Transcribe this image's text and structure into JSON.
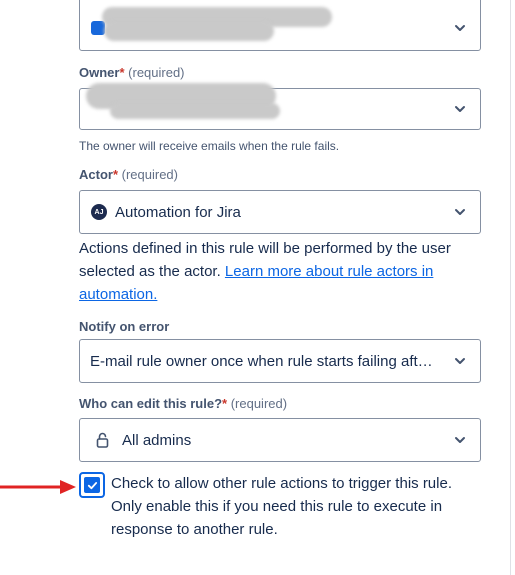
{
  "project_field": {
    "value": ""
  },
  "owner": {
    "label": "Owner",
    "required_star": "*",
    "required_text": "(required)",
    "value": "",
    "helper": "The owner will receive emails when the rule fails."
  },
  "actor": {
    "label": "Actor",
    "required_star": "*",
    "required_text": "(required)",
    "avatar_initials": "AJ",
    "value": "Automation for Jira",
    "description": "Actions defined in this rule will be performed by the user selected as the actor. ",
    "link_text": "Learn more about rule actors in automation."
  },
  "notify": {
    "label": "Notify on error",
    "value": "E-mail rule owner once when rule starts failing after success"
  },
  "edit_permission": {
    "label": "Who can edit this rule?",
    "required_star": "*",
    "required_text": "(required)",
    "value": "All admins"
  },
  "allow_trigger": {
    "checked": true,
    "label": "Check to allow other rule actions to trigger this rule. Only enable this if you need this rule to execute in response to another rule."
  },
  "colors": {
    "accent": "#0c66e4",
    "required": "#c9372c",
    "annotation_arrow": "#e02424"
  }
}
